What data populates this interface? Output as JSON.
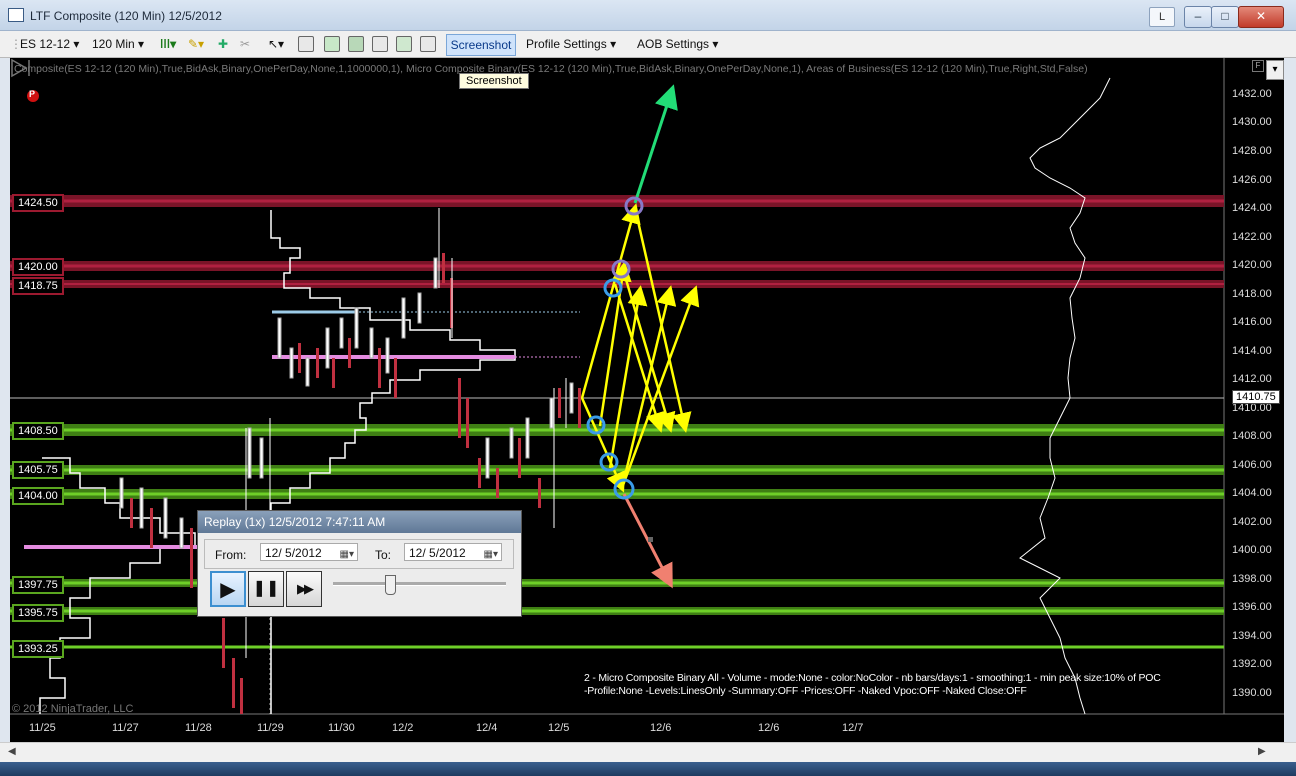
{
  "window": {
    "title": "LTF Composite (120 Min)  12/5/2012",
    "l_button": "L",
    "min": "–",
    "max": "□",
    "close": "✕"
  },
  "toolbar": {
    "instrument": "ES 12-12",
    "interval": "120 Min",
    "screenshot": "Screenshot",
    "profile_settings": "Profile Settings",
    "aob_settings": "AOB Settings"
  },
  "chart": {
    "params": "Composite(ES 12-12 (120 Min),True,BidAsk,Binary,OnePerDay,None,1,1000000,1), Micro Composite Binary(ES 12-12 (120 Min),True,BidAsk,Binary,OnePerDay,None,1), Areas of Business(ES 12-12 (120 Min),True,Right,Std,False)",
    "tooltip": "Screenshot",
    "marker": "P",
    "f_box": "F",
    "dropdown": "▾",
    "copyright": "© 2012 NinjaTrader, LLC",
    "current_price": "1410.75",
    "info_line1": "2 - Micro Composite Binary All - Volume - mode:None - color:NoColor - nb bars/days:1 - smoothing:1 - min peak size:10% of POC",
    "info_line2": "-Profile:None -Levels:LinesOnly -Summary:OFF -Prices:OFF -Naked Vpoc:OFF -Naked Close:OFF",
    "price_ticks": [
      "1432.00",
      "1430.00",
      "1428.00",
      "1426.00",
      "1424.00",
      "1422.00",
      "1420.00",
      "1418.00",
      "1416.00",
      "1414.00",
      "1412.00",
      "1410.00",
      "1408.00",
      "1406.00",
      "1404.00",
      "1402.00",
      "1400.00",
      "1398.00",
      "1396.00",
      "1394.00",
      "1392.00",
      "1390.00"
    ],
    "date_ticks": [
      "11/25",
      "11/27",
      "11/28",
      "11/29",
      "11/30",
      "12/2",
      "12/4",
      "12/5",
      "12/6",
      "12/6",
      "12/7"
    ],
    "resistance_levels": [
      "1424.50",
      "1420.00",
      "1418.75"
    ],
    "support_levels": [
      "1408.50",
      "1405.75",
      "1404.00",
      "1397.75",
      "1395.75",
      "1393.25"
    ],
    "colors": {
      "resistance": "#9c1a30",
      "support": "#5aa61f",
      "arrows": "#ffff00",
      "target_up": "#22dd77",
      "target_down": "#f08070",
      "circles": "#3a9be8"
    }
  },
  "replay": {
    "title": "Replay (1x) 12/5/2012 7:47:11 AM",
    "from_label": "From:",
    "from_value": "12/  5/2012",
    "to_label": "To:",
    "to_value": "12/  5/2012",
    "play": "▶",
    "pause": "❚❚",
    "fast_forward": "▶▶",
    "speed_fraction": 0.33
  }
}
